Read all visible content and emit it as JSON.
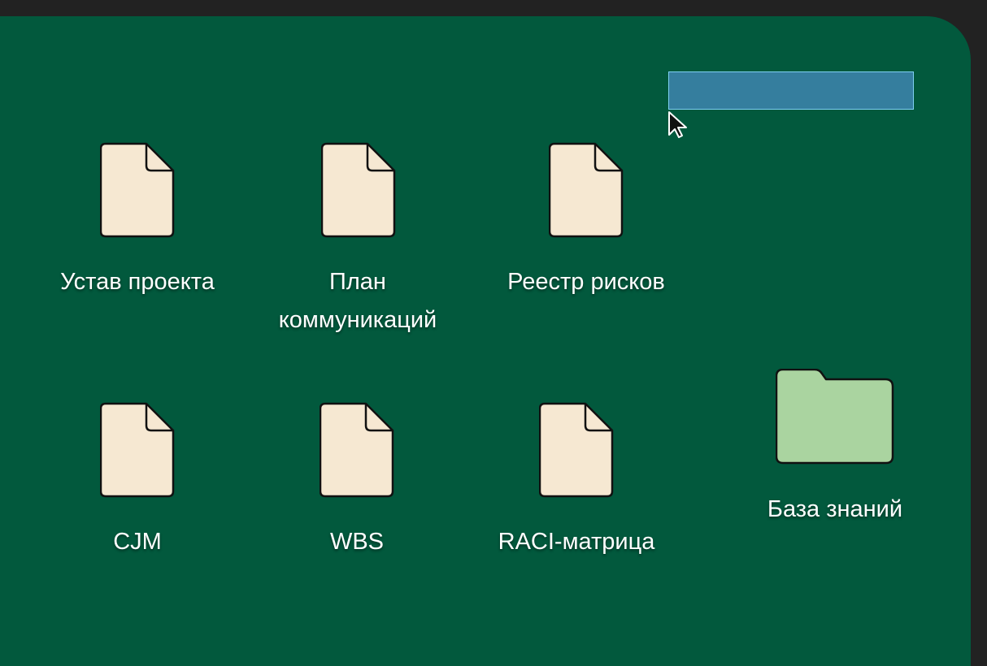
{
  "desktop": {
    "items": [
      {
        "label": "Устав проекта",
        "kind": "document",
        "icon": "document-icon"
      },
      {
        "label": "План\nкоммуникаций",
        "kind": "document",
        "icon": "document-icon"
      },
      {
        "label": "Реестр рисков",
        "kind": "document",
        "icon": "document-icon"
      },
      {
        "label": "CJM",
        "kind": "document",
        "icon": "document-icon"
      },
      {
        "label": "WBS",
        "kind": "document",
        "icon": "document-icon"
      },
      {
        "label": "RACI-матрица",
        "kind": "document",
        "icon": "document-icon"
      },
      {
        "label": "База знаний",
        "kind": "folder",
        "icon": "folder-icon"
      }
    ]
  },
  "colors": {
    "desktop_background": "#02593d",
    "frame": "#222222",
    "document_fill": "#f6e8d2",
    "folder_fill": "#aad4a0",
    "selection_fill": "#357e9e",
    "selection_border": "#7fd0f2"
  }
}
